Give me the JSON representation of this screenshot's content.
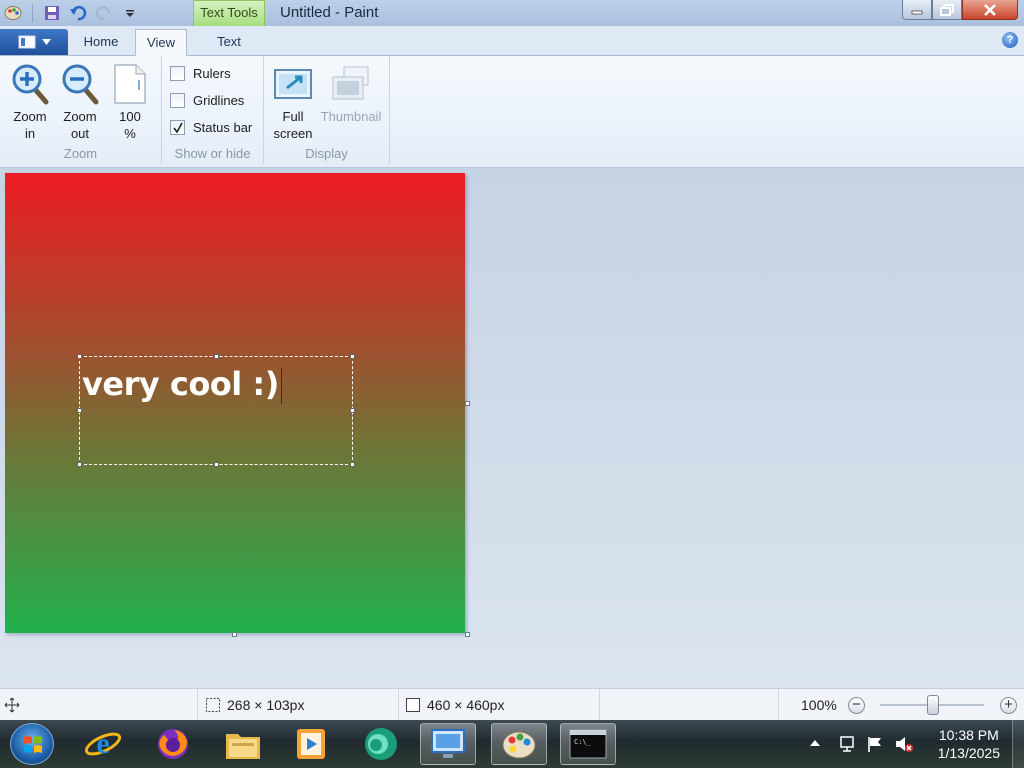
{
  "window": {
    "title": "Untitled - Paint",
    "context_tab": "Text Tools"
  },
  "ribbon": {
    "tabs": [
      {
        "label": "Home",
        "active": false
      },
      {
        "label": "View",
        "active": true
      },
      {
        "label": "Text",
        "active": false
      }
    ],
    "groups": {
      "zoom": {
        "label": "Zoom",
        "zoom_in": "Zoom\nin",
        "zoom_out": "Zoom\nout",
        "hundred": "100\n%"
      },
      "show_hide": {
        "label": "Show or hide",
        "rulers": {
          "label": "Rulers",
          "checked": false
        },
        "gridlines": {
          "label": "Gridlines",
          "checked": false
        },
        "statusbar": {
          "label": "Status bar",
          "checked": true
        }
      },
      "display": {
        "label": "Display",
        "fullscreen": "Full\nscreen",
        "thumbnail": "Thumbnail"
      }
    }
  },
  "canvas": {
    "text": "very cool :)",
    "gradient_top": "#ed1c24",
    "gradient_bottom": "#22b14c"
  },
  "statusbar": {
    "selection_size": "268 × 103px",
    "image_size": "460 × 460px",
    "zoom": "100%",
    "zoom_fraction": 0.5
  },
  "taskbar": {
    "icons": [
      "internet-explorer-icon",
      "firefox-icon",
      "file-explorer-icon",
      "media-player-icon",
      "app-icon",
      "remote-desktop-icon",
      "paint-icon",
      "command-prompt-icon"
    ],
    "time": "10:38 PM",
    "date": "1/13/2025"
  }
}
